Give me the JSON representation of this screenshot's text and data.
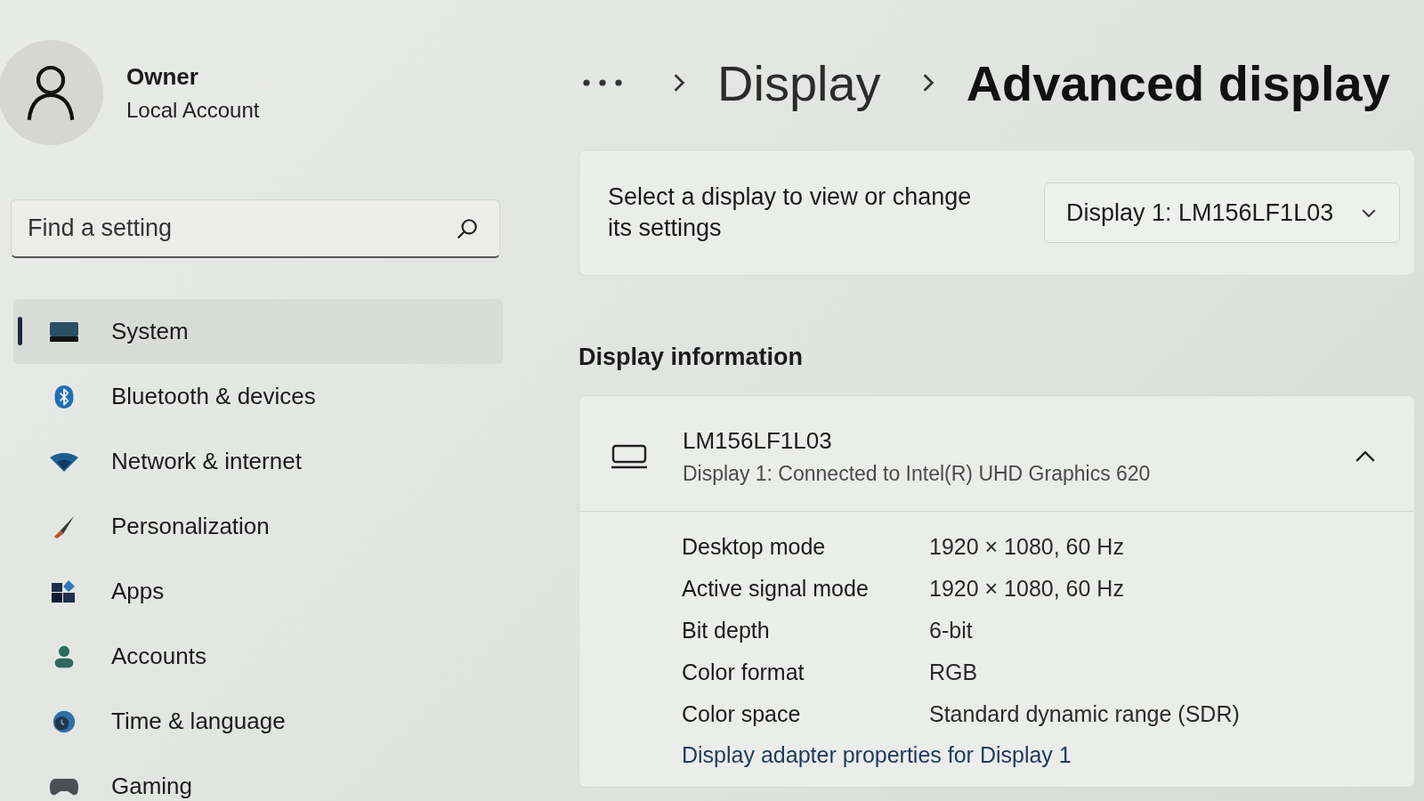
{
  "account": {
    "name": "Owner",
    "type": "Local Account"
  },
  "search": {
    "placeholder": "Find a setting"
  },
  "nav": [
    {
      "label": "System",
      "kind": "system",
      "selected": true
    },
    {
      "label": "Bluetooth & devices",
      "kind": "bluetooth",
      "selected": false
    },
    {
      "label": "Network & internet",
      "kind": "network",
      "selected": false
    },
    {
      "label": "Personalization",
      "kind": "personalization",
      "selected": false
    },
    {
      "label": "Apps",
      "kind": "apps",
      "selected": false
    },
    {
      "label": "Accounts",
      "kind": "accounts",
      "selected": false
    },
    {
      "label": "Time & language",
      "kind": "time",
      "selected": false
    },
    {
      "label": "Gaming",
      "kind": "gaming",
      "selected": false
    }
  ],
  "breadcrumb": {
    "parents": [
      "Display"
    ],
    "current": "Advanced display"
  },
  "display_picker": {
    "label": "Select a display to view or change its settings",
    "value": "Display 1: LM156LF1L03"
  },
  "section_title": "Display information",
  "display_info": {
    "name": "LM156LF1L03",
    "subtitle": "Display 1: Connected to Intel(R) UHD Graphics 620",
    "expanded": true,
    "rows": [
      {
        "label": "Desktop mode",
        "value": "1920 × 1080, 60 Hz"
      },
      {
        "label": "Active signal mode",
        "value": "1920 × 1080, 60 Hz"
      },
      {
        "label": "Bit depth",
        "value": "6-bit"
      },
      {
        "label": "Color format",
        "value": "RGB"
      },
      {
        "label": "Color space",
        "value": "Standard dynamic range (SDR)"
      }
    ],
    "link": "Display adapter properties for Display 1"
  }
}
